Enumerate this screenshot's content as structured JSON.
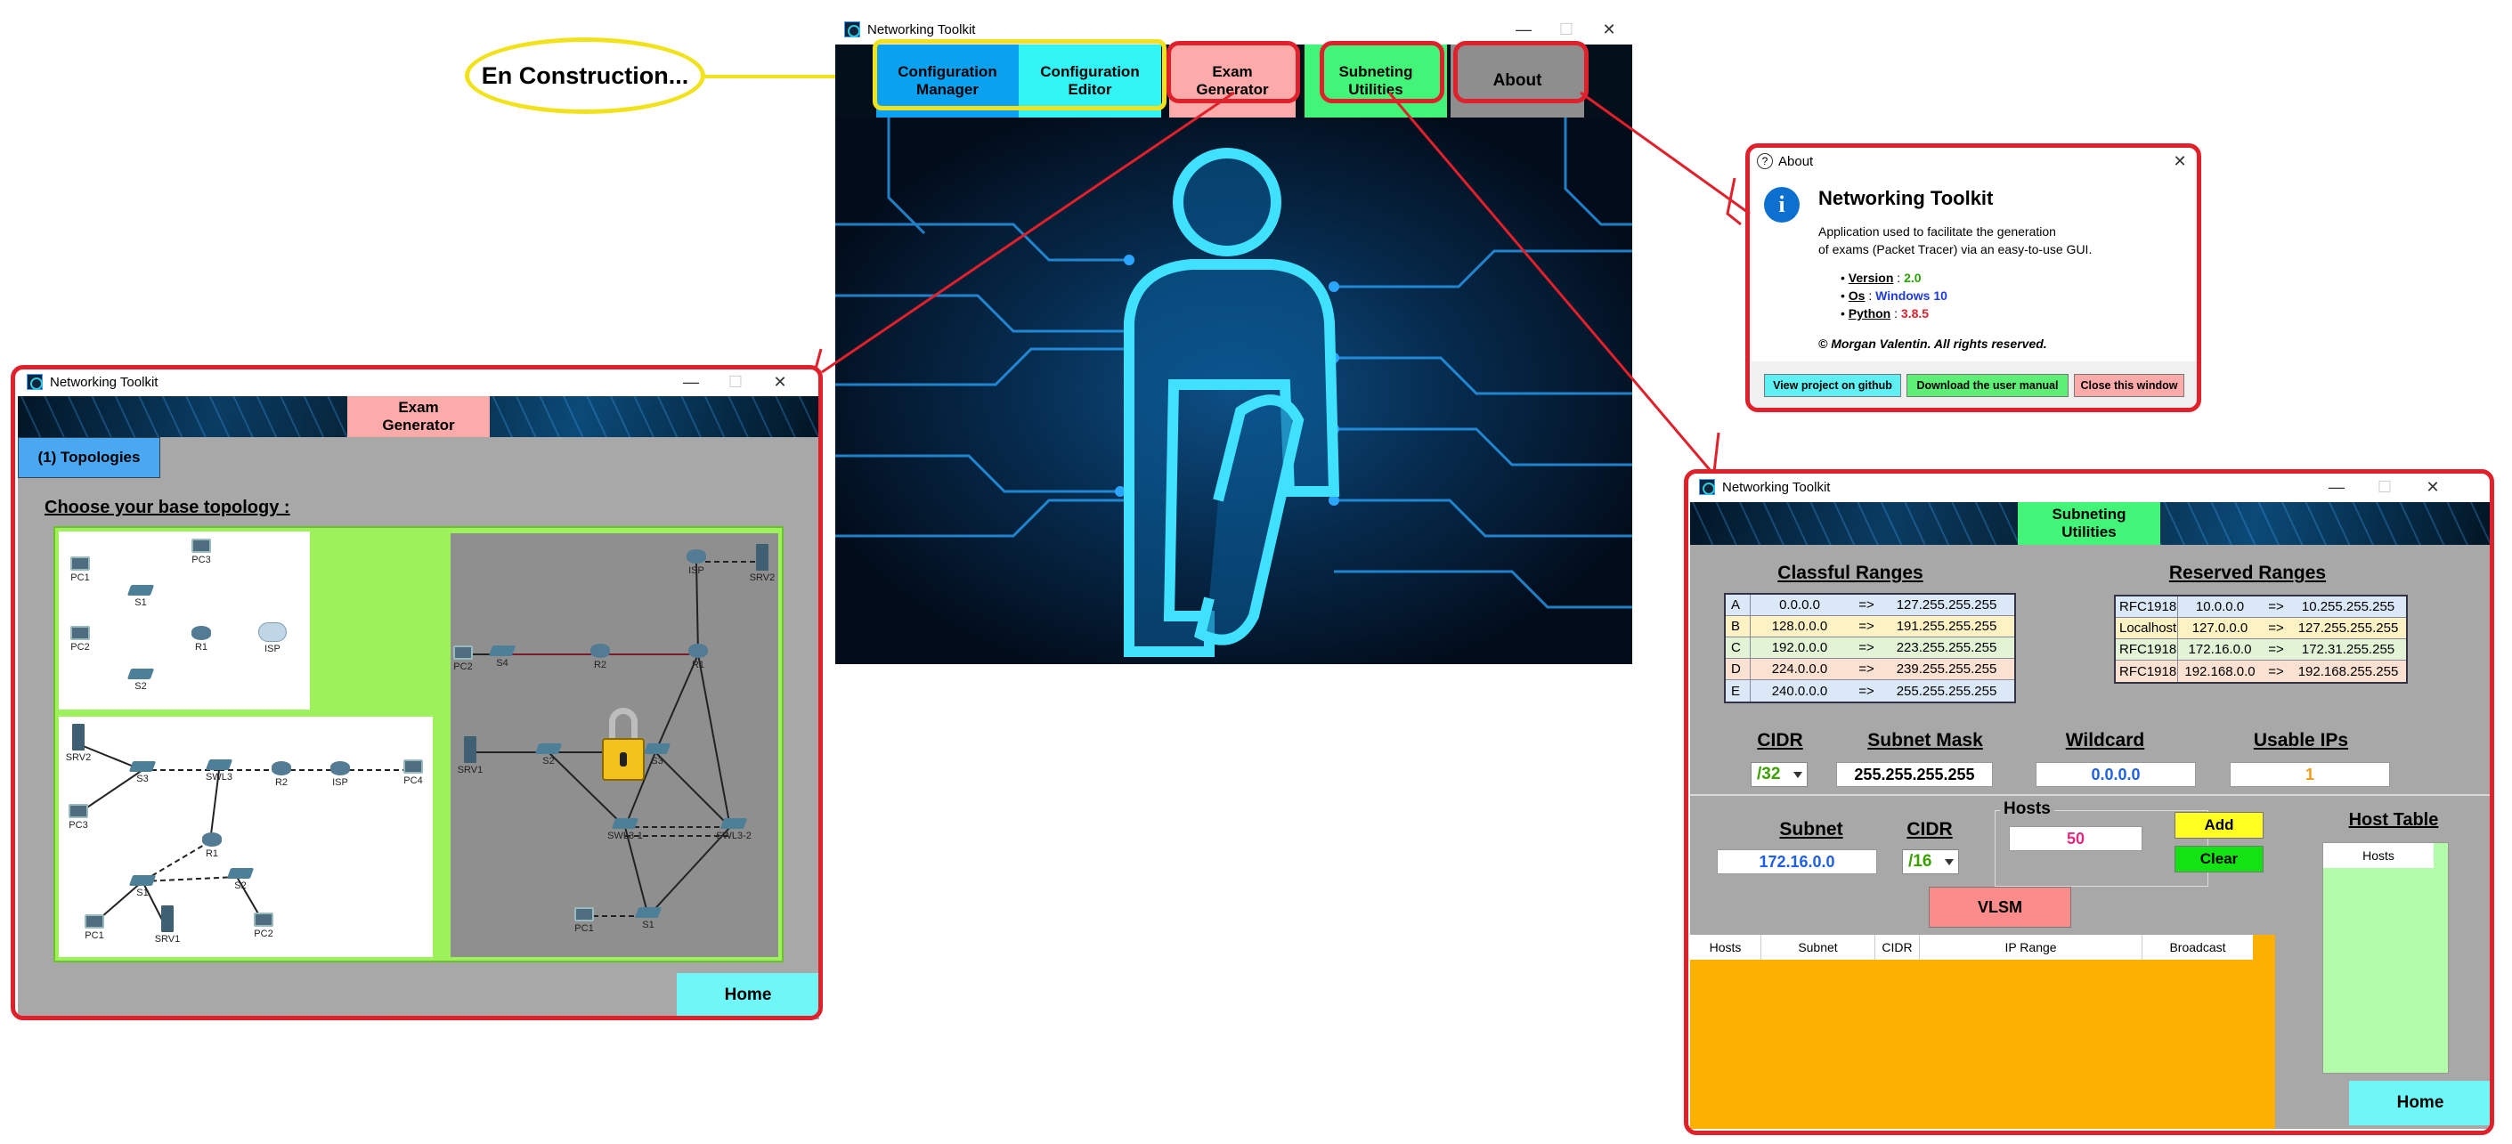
{
  "annotation": {
    "construction": "En Construction..."
  },
  "main": {
    "title": "Networking Toolkit",
    "buttons": {
      "config_manager": "Configuration\nManager",
      "config_editor": "Configuration\nEditor",
      "exam": "Exam\nGenerator",
      "subnet": "Subneting\nUtilities",
      "about": "About"
    }
  },
  "about": {
    "title": "About",
    "heading": "Networking Toolkit",
    "description_1": "Application used to facilitate the generation",
    "description_2": "of exams (Packet Tracer) via an easy-to-use GUI.",
    "version_label": "Version",
    "version_value": "2.0",
    "os_label": "Os",
    "os_value": "Windows 10",
    "python_label": "Python",
    "python_value": "3.8.5",
    "copyright": "© Morgan Valentin. All rights reserved.",
    "buttons": {
      "github": "View project on github",
      "manual": "Download the user manual",
      "close": "Close this window"
    }
  },
  "exam": {
    "title": "Networking Toolkit",
    "header": "Exam\nGenerator",
    "tab": "(1) Topologies",
    "heading": "Choose your base topology :",
    "home": "Home",
    "topo1": [
      "PC1",
      "PC3",
      "S1",
      "PC2",
      "R1",
      "ISP",
      "S2"
    ],
    "topo2": [
      "SRV2",
      "S3",
      "SWL3",
      "R2",
      "ISP",
      "PC4",
      "PC3",
      "R1",
      "S1",
      "S2",
      "PC1",
      "SRV1",
      "PC2"
    ],
    "topo3": [
      "ISP",
      "SRV2",
      "PC2",
      "S4",
      "R2",
      "R1",
      "S3",
      "SRV1",
      "S2",
      "SWL3-1",
      "SWL3-2",
      "PC1",
      "S1"
    ]
  },
  "subnet": {
    "title": "Networking Toolkit",
    "header": "Subneting\nUtilities",
    "classful_title": "Classful Ranges",
    "classful": [
      {
        "c": "A",
        "from": "0.0.0.0",
        "arrow": "=>",
        "to": "127.255.255.255",
        "color": "#dbe8f8"
      },
      {
        "c": "B",
        "from": "128.0.0.0",
        "arrow": "=>",
        "to": "191.255.255.255",
        "color": "#fdf2c4"
      },
      {
        "c": "C",
        "from": "192.0.0.0",
        "arrow": "=>",
        "to": "223.255.255.255",
        "color": "#e2f3d6"
      },
      {
        "c": "D",
        "from": "224.0.0.0",
        "arrow": "=>",
        "to": "239.255.255.255",
        "color": "#fbe1d2"
      },
      {
        "c": "E",
        "from": "240.0.0.0",
        "arrow": "=>",
        "to": "255.255.255.255",
        "color": "#dbe8f8"
      }
    ],
    "reserved_title": "Reserved Ranges",
    "reserved": [
      {
        "n": "RFC1918",
        "from": "10.0.0.0",
        "arrow": "=>",
        "to": "10.255.255.255",
        "color": "#dbe8f8"
      },
      {
        "n": "Localhost",
        "from": "127.0.0.0",
        "arrow": "=>",
        "to": "127.255.255.255",
        "color": "#fdf2c4"
      },
      {
        "n": "RFC1918",
        "from": "172.16.0.0",
        "arrow": "=>",
        "to": "172.31.255.255",
        "color": "#e2f3d6"
      },
      {
        "n": "RFC1918",
        "from": "192.168.0.0",
        "arrow": "=>",
        "to": "192.168.255.255",
        "color": "#fbe1d2"
      }
    ],
    "cidr_label": "CIDR",
    "mask_label": "Subnet Mask",
    "wildcard_label": "Wildcard",
    "usable_label": "Usable IPs",
    "cidr_value": "/32",
    "mask_value": "255.255.255.255",
    "wildcard_value": "0.0.0.0",
    "usable_value": "1",
    "subnet_label": "Subnet",
    "cidr2_label": "CIDR",
    "subnet_value": "172.16.0.0",
    "cidr2_value": "/16",
    "hosts_label": "Hosts",
    "hosts_value": "50",
    "add": "Add",
    "clear": "Clear",
    "vlsm": "VLSM",
    "host_table_title": "Host Table",
    "host_table_col": "Hosts",
    "columns": [
      "Hosts",
      "Subnet",
      "CIDR",
      "IP Range",
      "Broadcast"
    ],
    "home": "Home"
  }
}
